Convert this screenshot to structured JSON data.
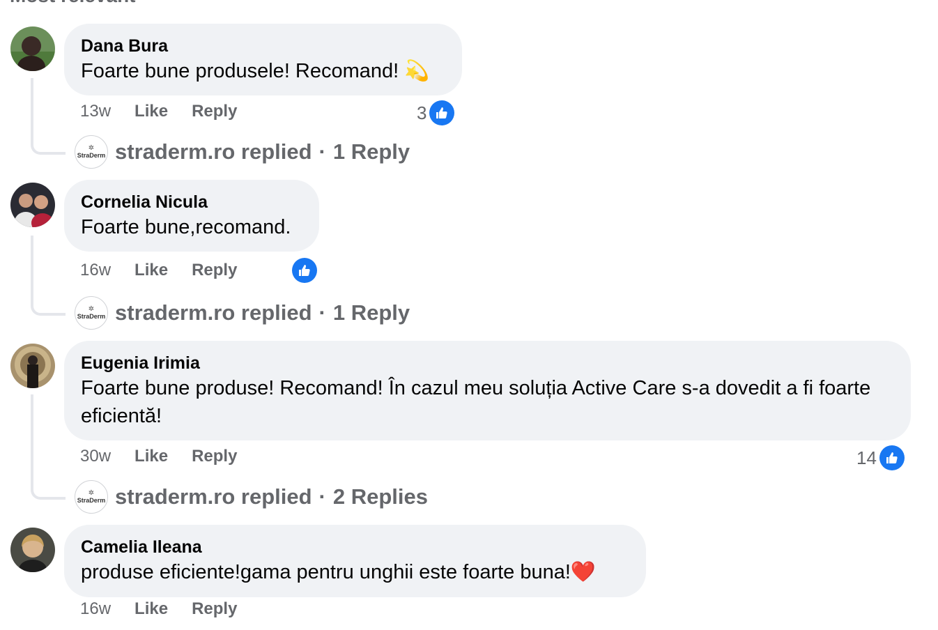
{
  "top_heading": "Most relevant",
  "comments": [
    {
      "author": "Dana Bura",
      "text": "Foarte bune produsele! Recomand! 💫",
      "time": "13w",
      "like_label": "Like",
      "reply_label": "Reply",
      "like_count": "3",
      "replied_by": "straderm.ro replied",
      "replies": "1 Reply"
    },
    {
      "author": "Cornelia Nicula",
      "text": "Foarte bune,recomand.",
      "time": "16w",
      "like_label": "Like",
      "reply_label": "Reply",
      "like_count": "",
      "replied_by": "straderm.ro replied",
      "replies": "1 Reply"
    },
    {
      "author": "Eugenia Irimia",
      "text": "Foarte bune produse! Recomand! În cazul meu soluția Active Care s-a dovedit a fi foarte eficientă!",
      "time": "30w",
      "like_label": "Like",
      "reply_label": "Reply",
      "like_count": "14",
      "replied_by": "straderm.ro replied",
      "replies": "2 Replies"
    },
    {
      "author": "Camelia Ileana",
      "text": "produse eficiente!gama pentru unghii este foarte buna!❤️",
      "time": "16w",
      "like_label": "Like",
      "reply_label": "Reply"
    }
  ],
  "page_avatar_label": "StraDerm",
  "separator": "·",
  "colors": {
    "bubble": "#f0f2f5",
    "meta_text": "#65676b",
    "like_blue": "#1877f2",
    "thread_line": "#e4e6eb"
  }
}
